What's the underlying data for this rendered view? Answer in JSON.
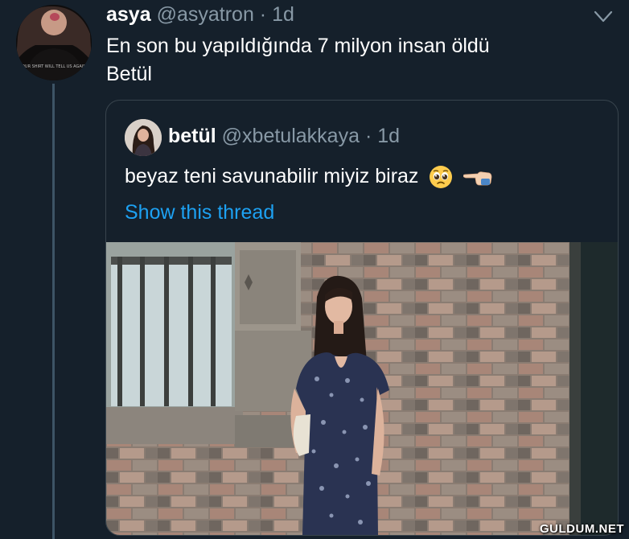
{
  "tweet": {
    "display_name": "asya",
    "handle": "@asyatron",
    "separator": "·",
    "time": "1d",
    "text_line1": "En son bu yapıldığında 7 milyon insan öldü",
    "text_line2": "Betül",
    "avatar_shirt_text": "OUR SHIRT WILL TELL US AGAIN"
  },
  "quoted_tweet": {
    "display_name": "betül",
    "handle": "@xbetulakkaya",
    "separator": "·",
    "time": "1d",
    "text": "beyaz teni savunabilir miyiz biraz",
    "emojis": [
      "pleading-face-emoji",
      "backhand-index-pointing-left-emoji"
    ],
    "show_thread_label": "Show this thread"
  },
  "icons": {
    "more_options": "chevron-down-icon"
  },
  "watermark": "GULDUM.NET",
  "colors": {
    "background": "#15202b",
    "text_primary": "#ffffff",
    "text_secondary": "#8899a6",
    "link": "#1da1f2",
    "border": "#38444d"
  }
}
